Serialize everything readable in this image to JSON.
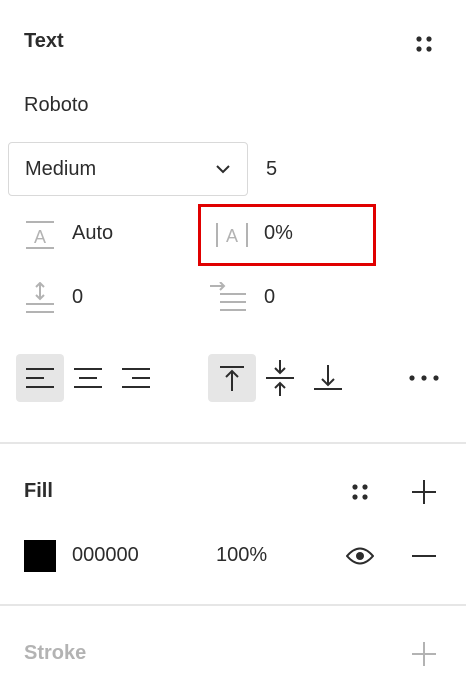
{
  "text_section": {
    "title": "Text",
    "font_family": "Roboto",
    "font_weight": "Medium",
    "font_size": "5",
    "line_height": "Auto",
    "letter_spacing": "0%",
    "paragraph_spacing": "0",
    "paragraph_indent": "0"
  },
  "fill_section": {
    "title": "Fill",
    "color_hex": "000000",
    "opacity": "100%",
    "swatch_color": "#000000"
  },
  "stroke_section": {
    "title": "Stroke"
  },
  "colors": {
    "highlight": "#e00000",
    "active_bg": "#e6e6e6",
    "muted": "#b3b3b3"
  },
  "icons": {
    "styles": "grid-dots-icon",
    "weight_dropdown": "chevron-down-icon",
    "line_height": "line-height-icon",
    "letter_spacing": "letter-spacing-icon",
    "paragraph_spacing": "paragraph-spacing-icon",
    "paragraph_indent": "paragraph-indent-icon",
    "more": "more-horizontal-icon",
    "visibility": "eye-icon",
    "add": "plus-icon",
    "remove": "minus-icon"
  }
}
